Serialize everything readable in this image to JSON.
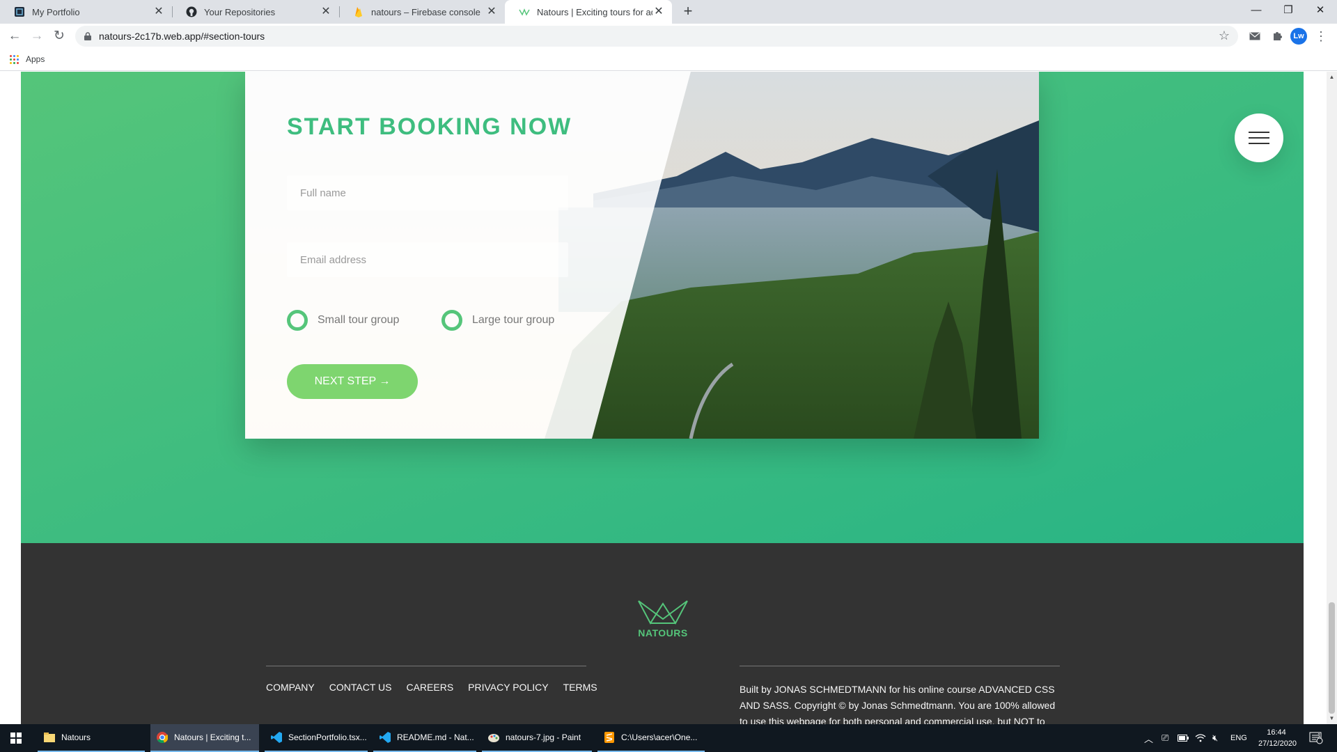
{
  "browser": {
    "tabs": [
      {
        "title": "My Portfolio",
        "active": false
      },
      {
        "title": "Your Repositories",
        "active": false
      },
      {
        "title": "natours – Firebase console",
        "active": false
      },
      {
        "title": "Natours | Exciting tours for adve",
        "active": true
      }
    ],
    "url": "natours-2c17b.web.app/#section-tours",
    "bookmarks": {
      "apps_label": "Apps"
    },
    "avatar_initials": "Lw"
  },
  "page": {
    "booking": {
      "title": "START BOOKING NOW",
      "name_placeholder": "Full name",
      "email_placeholder": "Email address",
      "radio_small": "Small tour group",
      "radio_large": "Large tour group",
      "next_button": "NEXT STEP →"
    },
    "footer": {
      "logo_text": "NATOURS",
      "nav": [
        "COMPANY",
        "CONTACT US",
        "CAREERS",
        "PRIVACY POLICY",
        "TERMS"
      ],
      "copyright": "Built by JONAS SCHMEDTMANN for his online course ADVANCED CSS AND SASS. Copyright © by Jonas Schmedtmann. You are 100% allowed to use this webpage for both personal and commercial use, but NOT to claim it"
    }
  },
  "taskbar": {
    "items": [
      "Natours",
      "Natours | Exciting t...",
      "SectionPortfolio.tsx...",
      "README.md - Nat...",
      "natours-7.jpg - Paint",
      "C:\\Users\\acer\\One..."
    ],
    "language": "ENG",
    "time": "16:44",
    "date": "27/12/2020",
    "notification_count": "1"
  },
  "colors": {
    "brand_green_light": "#55c57a",
    "brand_green_dark": "#28b485",
    "button_green": "#7ed56f",
    "footer_bg": "#333333",
    "taskbar_bg": "#101820"
  }
}
